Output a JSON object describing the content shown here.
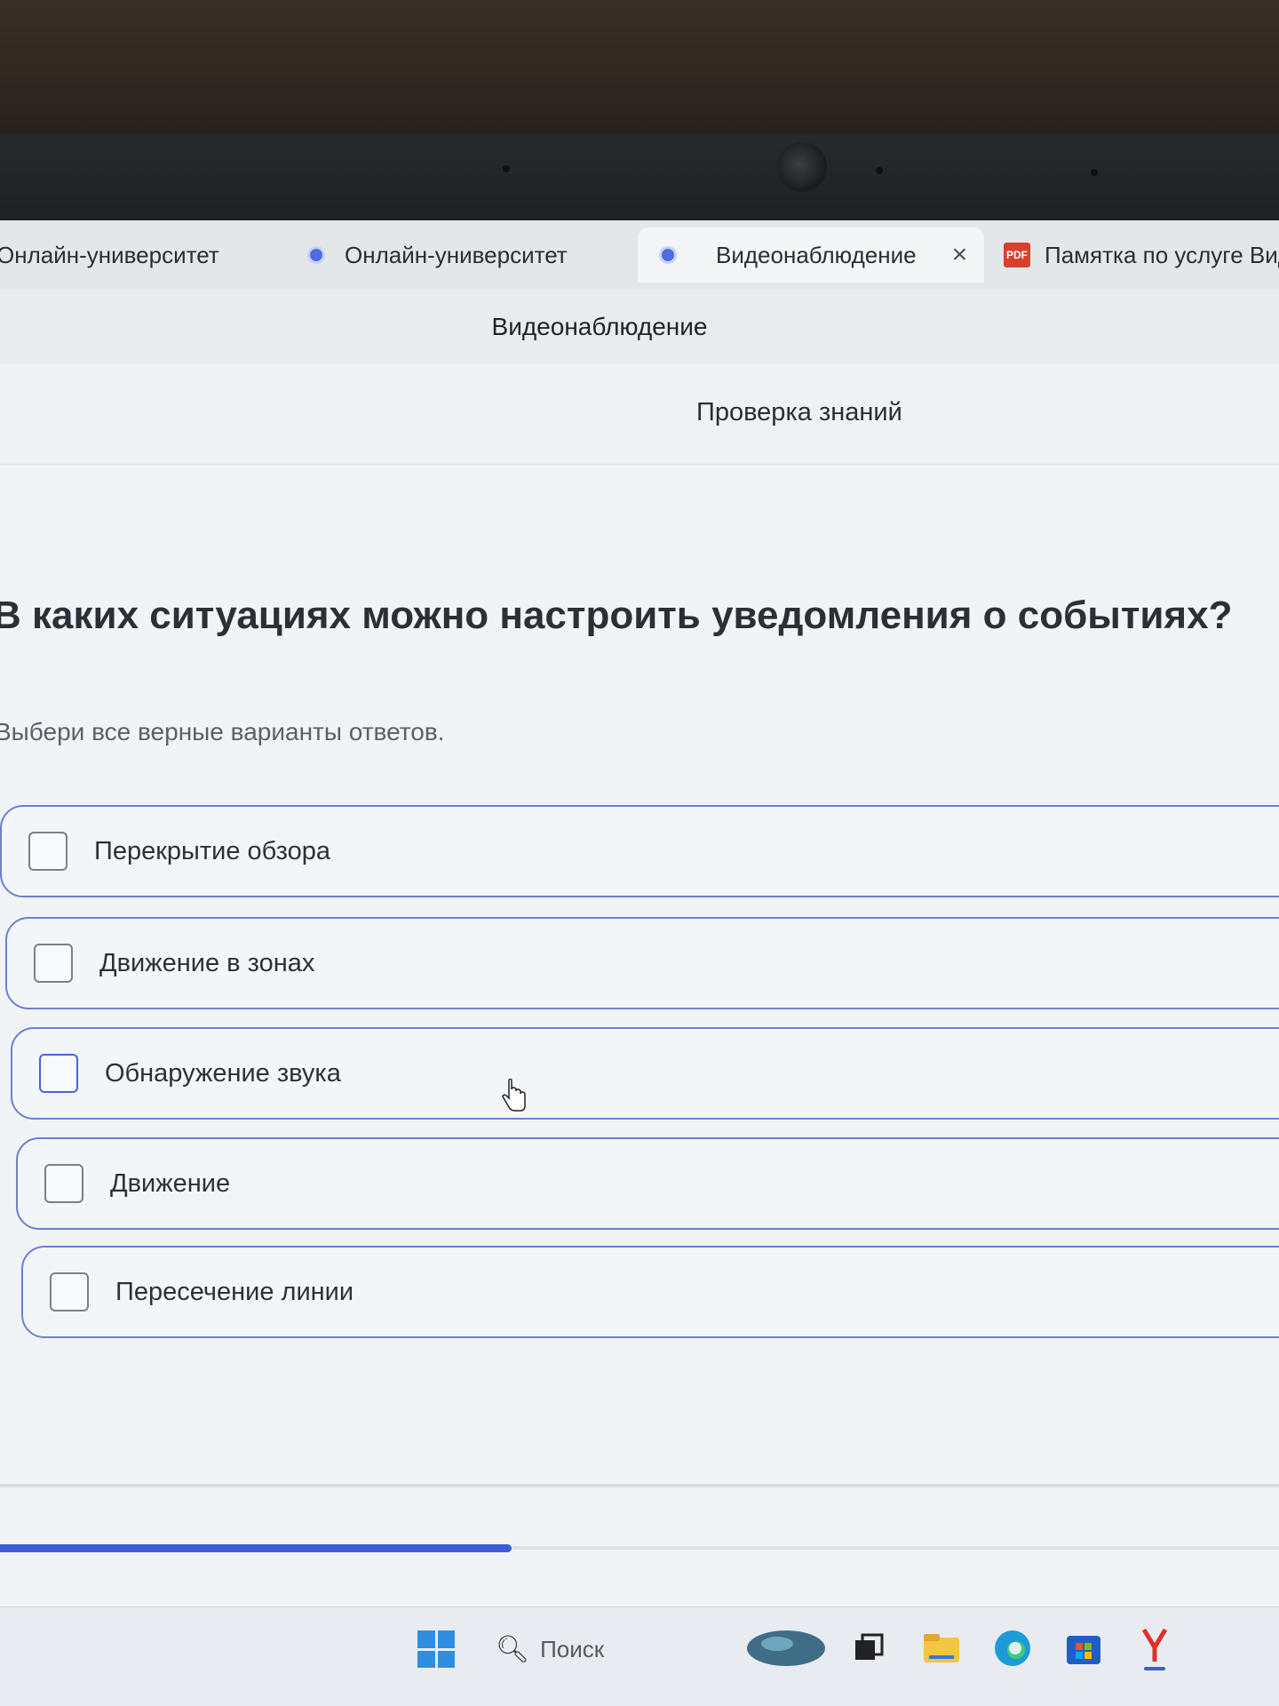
{
  "tabs": [
    {
      "label": "Онлайн-университет",
      "icon": "globe-icon",
      "active": false
    },
    {
      "label": "Онлайн-университет",
      "icon": "globe-icon",
      "active": false
    },
    {
      "label": "Видеонаблюдение",
      "icon": "globe-icon",
      "active": true,
      "close": "×"
    },
    {
      "label": "Памятка по услуге Вид",
      "icon": "pdf-icon",
      "icon_text": "PDF",
      "active": false
    }
  ],
  "header": {
    "title": "Видеонаблюдение"
  },
  "section": {
    "title": "Проверка знаний"
  },
  "question": {
    "text": "В каких ситуациях можно настроить уведомления о событиях?",
    "instruction": "Выбери все верные варианты ответов."
  },
  "options": [
    {
      "label": "Перекрытие обзора",
      "checked": false
    },
    {
      "label": "Движение в зонах",
      "checked": false
    },
    {
      "label": "Обнаружение звука",
      "checked": false
    },
    {
      "label": "Движение",
      "checked": false
    },
    {
      "label": "Пересечение линии",
      "checked": false
    }
  ],
  "progress": {
    "fraction": 0.4
  },
  "taskbar": {
    "search_placeholder": "Поиск",
    "icons": [
      "windows-start-icon",
      "search-icon",
      "widgets-icon",
      "task-view-icon",
      "file-explorer-icon",
      "edge-icon",
      "store-icon",
      "yandex-browser-icon"
    ]
  },
  "colors": {
    "accent": "#3f5bd4",
    "option_border": "#6c7fd3",
    "question_text": "#2b3036"
  }
}
